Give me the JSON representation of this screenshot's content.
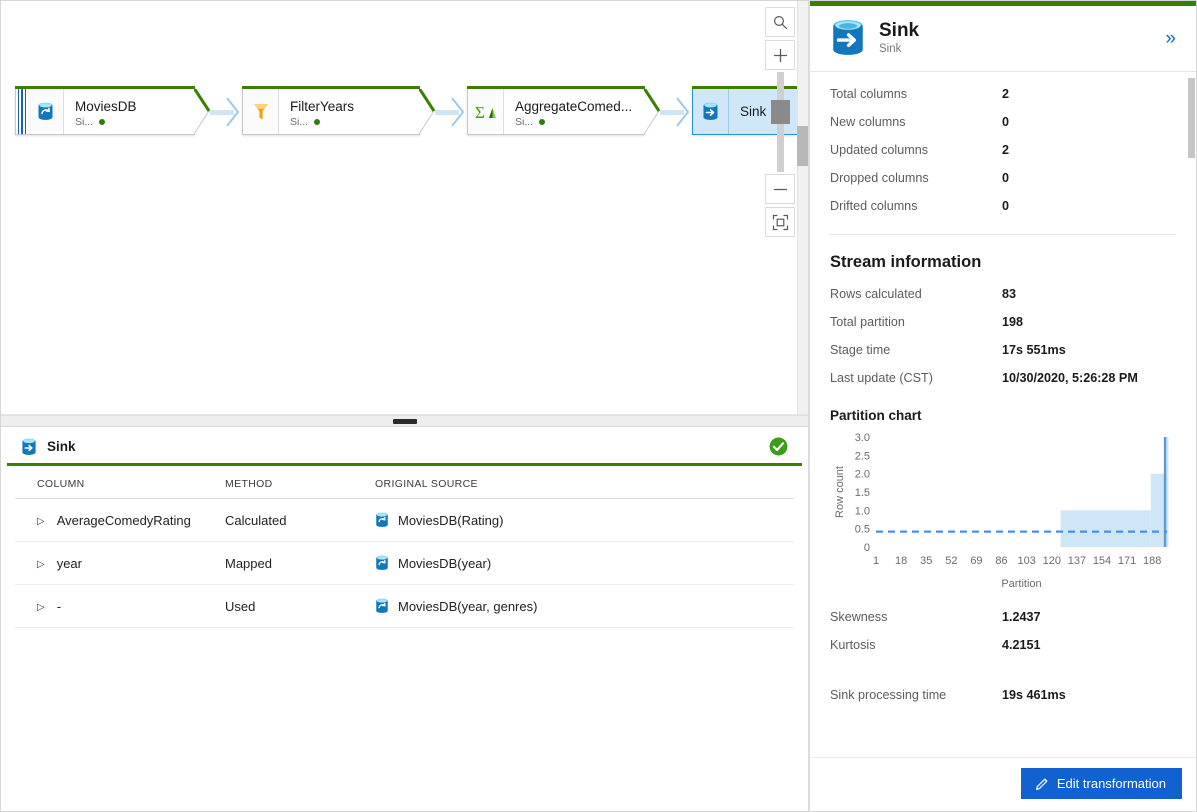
{
  "canvas": {
    "nodes": [
      {
        "name": "MoviesDB",
        "subtitle": "Si...",
        "icon": "source-database-icon",
        "type": "source"
      },
      {
        "name": "FilterYears",
        "subtitle": "Si...",
        "icon": "filter-funnel-icon",
        "type": "filter"
      },
      {
        "name": "AggregateComed...",
        "subtitle": "Si...",
        "icon": "aggregate-sigma-icon",
        "type": "aggregate"
      },
      {
        "name": "Sink",
        "subtitle": "",
        "icon": "sink-database-icon",
        "type": "sink"
      }
    ],
    "toolbar": {
      "search": "search-icon",
      "zoom_in": "plus-icon",
      "zoom_out": "minus-icon",
      "fit_to_screen": "fit-screen-icon"
    }
  },
  "inspect": {
    "title": "Sink",
    "status_icon": "success-check-icon",
    "columns": [
      "COLUMN",
      "METHOD",
      "ORIGINAL SOURCE"
    ],
    "rows": [
      {
        "column": "AverageComedyRating",
        "method": "Calculated",
        "source": "MoviesDB(Rating)"
      },
      {
        "column": "year",
        "method": "Mapped",
        "source": "MoviesDB(year)"
      },
      {
        "column": "-",
        "method": "Used",
        "source": "MoviesDB(year, genres)"
      }
    ]
  },
  "panel": {
    "title": "Sink",
    "subtitle": "Sink",
    "collapse_icon": "double-chevron-right-icon",
    "column_stats": [
      {
        "label": "Total columns",
        "value": "2"
      },
      {
        "label": "New columns",
        "value": "0"
      },
      {
        "label": "Updated columns",
        "value": "2"
      },
      {
        "label": "Dropped columns",
        "value": "0"
      },
      {
        "label": "Drifted columns",
        "value": "0"
      }
    ],
    "stream_information_title": "Stream information",
    "stream_stats": [
      {
        "label": "Rows calculated",
        "value": "83"
      },
      {
        "label": "Total partition",
        "value": "198"
      },
      {
        "label": "Stage time",
        "value": "17s 551ms"
      },
      {
        "label": "Last update (CST)",
        "value": "10/30/2020, 5:26:28 PM"
      }
    ],
    "distribution_stats": [
      {
        "label": "Skewness",
        "value": "1.2437"
      },
      {
        "label": "Kurtosis",
        "value": "4.2151"
      }
    ],
    "processing_stats": [
      {
        "label": "Sink processing time",
        "value": "19s 461ms"
      }
    ],
    "edit_button": "Edit transformation",
    "edit_button_icon": "pencil-icon"
  },
  "chart_data": {
    "type": "bar",
    "title": "Partition chart",
    "xlabel": "Partition",
    "ylabel": "Row count",
    "xticks": [
      1,
      18,
      35,
      52,
      69,
      86,
      103,
      120,
      137,
      154,
      171,
      188
    ],
    "yticks": [
      "0",
      "0.5",
      "1.0",
      "1.5",
      "2.0",
      "2.5",
      "3.0"
    ],
    "ylim": [
      0,
      3.0
    ],
    "xlim": [
      1,
      198
    ],
    "grid": false,
    "legend": false,
    "bar_color": "#cfe6f7",
    "average_line": {
      "value": 0.42,
      "style": "dashed",
      "color": "#4a90e2"
    },
    "note": "Rows are empty for partitions 1-125; a plateau of row count 1 from partition ~126 to ~186, rising to 2 for ~187-195, and a single tall bar reaching 3 at partition ~197.",
    "bars": [
      {
        "x_start": 1,
        "x_end": 125,
        "value": 0
      },
      {
        "x_start": 126,
        "x_end": 186,
        "value": 1
      },
      {
        "x_start": 187,
        "x_end": 195,
        "value": 2
      },
      {
        "x_start": 196,
        "x_end": 198,
        "value": 3
      }
    ]
  }
}
